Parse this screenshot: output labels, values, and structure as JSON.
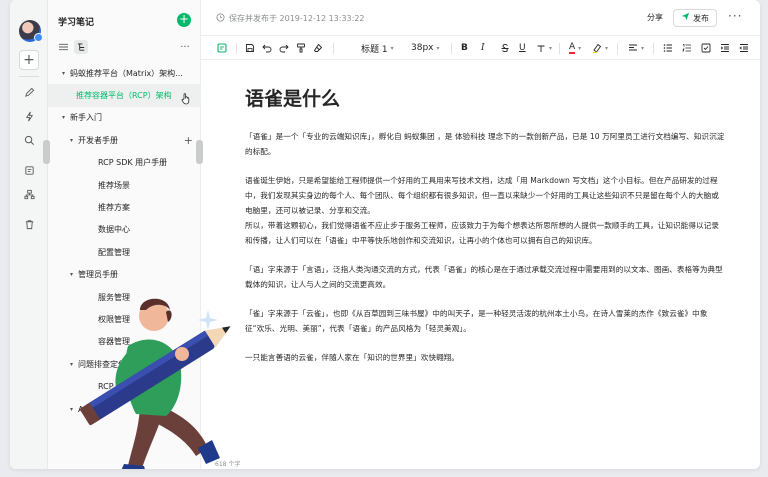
{
  "sidebar": {
    "title": "学习笔记",
    "tree": [
      {
        "label": "蚂蚁推荐平台（Matrix）架构...",
        "level": 0,
        "caret": "▾"
      },
      {
        "label": "推荐容器平台（RCP）架构",
        "level": 1,
        "caret": "",
        "selected": true
      },
      {
        "label": "新手入门",
        "level": 0,
        "caret": "▾"
      },
      {
        "label": "开发者手册",
        "level": 1,
        "caret": "▾"
      },
      {
        "label": "RCP SDK 用户手册",
        "level": 2,
        "caret": ""
      },
      {
        "label": "推荐场景",
        "level": 2,
        "caret": ""
      },
      {
        "label": "推荐方案",
        "level": 2,
        "caret": ""
      },
      {
        "label": "数据中心",
        "level": 2,
        "caret": ""
      },
      {
        "label": "配置管理",
        "level": 2,
        "caret": ""
      },
      {
        "label": "管理员手册",
        "level": 1,
        "caret": "▾"
      },
      {
        "label": "服务管理",
        "level": 2,
        "caret": ""
      },
      {
        "label": "权限管理",
        "level": 2,
        "caret": ""
      },
      {
        "label": "容器管理",
        "level": 2,
        "caret": ""
      },
      {
        "label": "问题排查定位",
        "level": 1,
        "caret": "▾"
      },
      {
        "label": "RCP 使用",
        "level": 2,
        "caret": ""
      },
      {
        "label": "API 文档",
        "level": 1,
        "caret": "▾"
      }
    ]
  },
  "header": {
    "save_status": "保存并发布于 2019-12-12 13:33:22",
    "share_label": "分享",
    "publish_label": "发布",
    "more_label": "···"
  },
  "toolbar": {
    "heading_label": "标题 1",
    "font_size_label": "38px"
  },
  "document": {
    "title": "语雀是什么",
    "paragraphs": [
      "「语雀」是一个「专业的云端知识库」，孵化自 蚂蚁集团 ，是 体验科技 理念下的一款创新产品，已是 10 万阿里员工进行文档编写、知识沉淀的标配。",
      "",
      "语雀诞生伊始，只是希望能给工程师提供一个好用的工具用来写技术文档，达成「用 Markdown 写文档」这个小目标。但在产品研发的过程中，我们发现其实身边的每个人、每个团队、每个组织都有很多知识，但一直以来缺少一个好用的工具让这些知识不只是留在每个人的大脑或电脑里，还可以被记录、分享和交流。",
      "所以，带着这颗初心，我们觉得语雀不应止步于服务工程师，应该致力于为每个想表达所思所想的人提供一款顺手的工具，让知识能得以记录和传播，让人们可以在「语雀」中平等快乐地创作和交流知识，让再小的个体也可以拥有自己的知识库。",
      "",
      "「语」字来源于「言语」，泛指人类沟通交流的方式，代表「语雀」的核心是在于通过承载交流过程中需要用到的以文本、图画、表格等为典型载体的知识，让人与人之间的交流更高效。",
      "",
      "「雀」字来源于「云雀」，也即《从百草园到三味书屋》中的叫天子，是一种轻灵活泼的杭州本土小鸟，在诗人雪莱的杰作《致云雀》中象征“欢乐、光明、美丽”，代表「语雀」的产品风格为「轻灵美观」。",
      "",
      "一只能言善语的云雀，伴随人家在「知识的世界里」欢快翱翔。"
    ],
    "word_count": "618 个字"
  },
  "colors": {
    "accent": "#00b96b",
    "sidebar_bg": "#fafafa",
    "rail_bg": "#f4f5f5",
    "text": "#262626",
    "muted": "#8a8f8d"
  }
}
